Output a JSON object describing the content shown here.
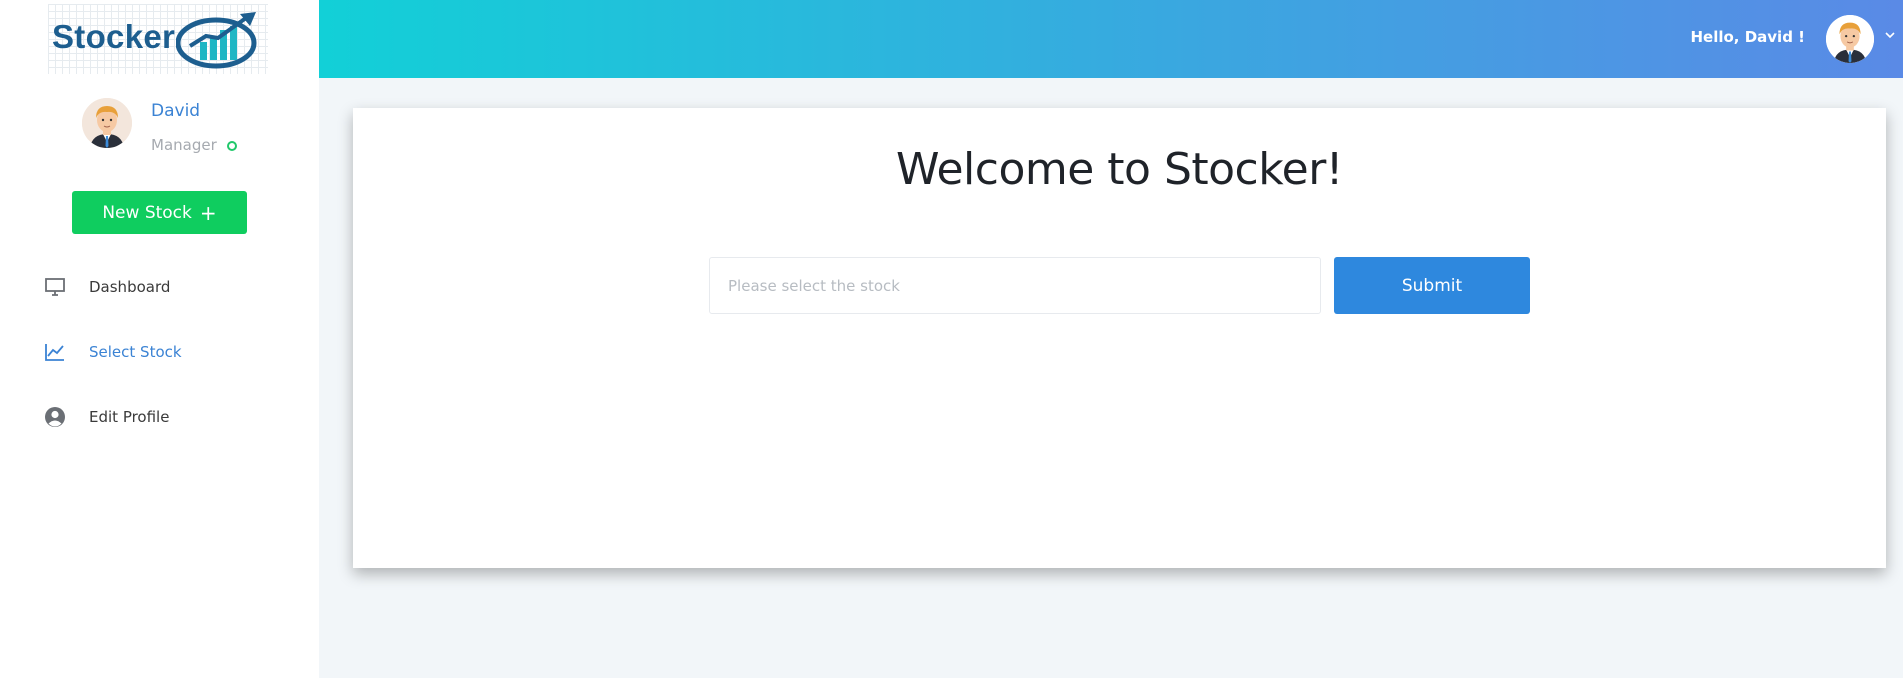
{
  "logo": {
    "text": "Stocker"
  },
  "sidebar": {
    "user": {
      "name": "David",
      "role": "Manager",
      "status_color": "#21c86b"
    },
    "new_stock_button": {
      "label": "New Stock",
      "icon": "plus-icon"
    },
    "nav": [
      {
        "label": "Dashboard",
        "icon": "monitor-icon",
        "active": false
      },
      {
        "label": "Select Stock",
        "icon": "line-chart-icon",
        "active": true
      },
      {
        "label": "Edit Profile",
        "icon": "user-circle-icon",
        "active": false
      }
    ]
  },
  "header": {
    "greeting": "Hello, David !",
    "avatar_icon": "user-avatar",
    "dropdown_icon": "chevron-down-icon"
  },
  "main": {
    "title": "Welcome to Stocker!",
    "stock_input": {
      "value": "",
      "placeholder": "Please select the stock"
    },
    "submit_label": "Submit"
  },
  "colors": {
    "accent": "#2e88de",
    "new_stock_green": "#0fcd5f",
    "active_nav": "#3b83d4",
    "header_gradient_start": "#12d0d7",
    "header_gradient_end": "#5a8ae6"
  }
}
